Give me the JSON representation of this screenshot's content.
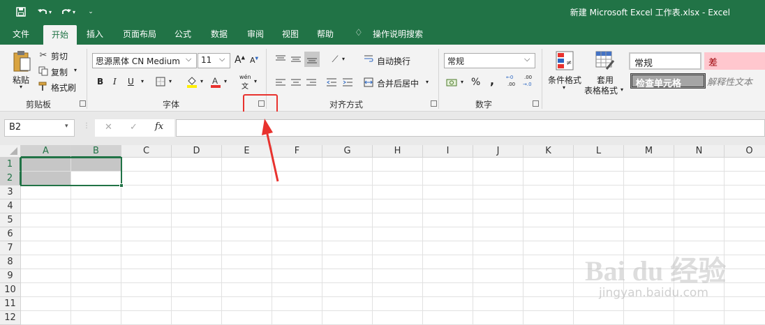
{
  "window": {
    "title": "新建 Microsoft Excel 工作表.xlsx  -  Excel"
  },
  "qat": {
    "save_icon": "save-icon",
    "undo_icon": "undo-icon",
    "redo_icon": "redo-icon",
    "customize_icon": "chevron-down-icon"
  },
  "tabs": [
    {
      "label": "文件",
      "active": false
    },
    {
      "label": "开始",
      "active": true
    },
    {
      "label": "插入",
      "active": false
    },
    {
      "label": "页面布局",
      "active": false
    },
    {
      "label": "公式",
      "active": false
    },
    {
      "label": "数据",
      "active": false
    },
    {
      "label": "审阅",
      "active": false
    },
    {
      "label": "视图",
      "active": false
    },
    {
      "label": "帮助",
      "active": false
    }
  ],
  "tellme": {
    "label": "操作说明搜索"
  },
  "clipboard": {
    "paste": "粘贴",
    "cut": "剪切",
    "copy": "复制",
    "format_painter": "格式刷",
    "group": "剪贴板"
  },
  "font": {
    "name": "思源黑体 CN Medium",
    "size": "11",
    "bold": "B",
    "italic": "I",
    "underline": "U",
    "grow": "A",
    "shrink": "A",
    "phonetic_top": "wén",
    "phonetic_bottom": "文",
    "group": "字体"
  },
  "alignment": {
    "wrap": "自动换行",
    "merge": "合并后居中",
    "group": "对齐方式"
  },
  "number": {
    "format": "常规",
    "percent": "%",
    "comma": ",",
    "inc_top": "←0",
    "inc_bottom": ".00",
    "dec_top": ".00",
    "dec_bottom": "→.0",
    "group": "数字"
  },
  "styles": {
    "conditional": "条件格式",
    "table_top": "套用",
    "table_bottom": "表格格式",
    "normal": "常规",
    "bad": "差",
    "check": "检查单元格",
    "explanatory": "解释性文本"
  },
  "formula_bar": {
    "name_box": "B2",
    "cancel": "✕",
    "enter": "✓",
    "fx": "fx",
    "formula": ""
  },
  "columns": [
    "A",
    "B",
    "C",
    "D",
    "E",
    "F",
    "G",
    "H",
    "I",
    "J",
    "K",
    "L",
    "M",
    "N",
    "O"
  ],
  "rows": [
    "1",
    "2",
    "3",
    "4",
    "5",
    "6",
    "7",
    "8",
    "9",
    "10",
    "11",
    "12"
  ],
  "selection": {
    "range": "A1:B2",
    "active_cell": "B2"
  },
  "watermark": {
    "brand": "Bai du 经验",
    "url": "jingyan.baidu.com"
  },
  "colors": {
    "excel_green": "#217346",
    "annotation_red": "#e8322e",
    "bad_fill": "#ffc7ce",
    "selection_fill": "#c6c6c6"
  }
}
